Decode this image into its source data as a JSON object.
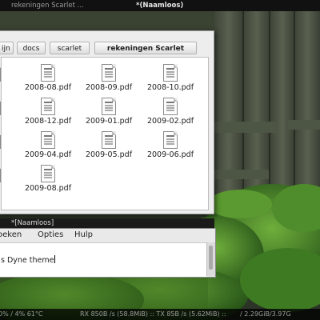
{
  "taskbar": {
    "tasks": [
      {
        "title": "rekeningen Scarlet ..."
      },
      {
        "title": "*(Naamloos)"
      }
    ]
  },
  "file_manager": {
    "breadcrumbs": [
      "ijn",
      "docs",
      "scarlet",
      "rekeningen Scarlet"
    ],
    "files": [
      {
        "name": "pdf"
      },
      {
        "name": "2008-08.pdf"
      },
      {
        "name": "2008-09.pdf"
      },
      {
        "name": "2008-10.pdf"
      },
      {
        "name": "pdf"
      },
      {
        "name": "2008-12.pdf"
      },
      {
        "name": "2009-01.pdf"
      },
      {
        "name": "2009-02.pdf"
      },
      {
        "name": "pdf"
      },
      {
        "name": "2009-04.pdf"
      },
      {
        "name": "2009-05.pdf"
      },
      {
        "name": "2009-06.pdf"
      },
      {
        "name": "pdf"
      },
      {
        "name": "2009-08.pdf"
      }
    ],
    "file_icon": "pdf-document-icon"
  },
  "editor": {
    "title": "*[Naamloos]",
    "menus": [
      "oeken",
      "Opties",
      "Hulp"
    ],
    "text": "s Dyne theme"
  },
  "statusbar": {
    "cpu": "0% / 4% 61°C",
    "net": "RX 850B /s (58.8MiB) :: TX 85B /s (5.62MiB) ::",
    "mem": "/ 2.29GiB/3.97G"
  },
  "colors": {
    "window_bg": "#ededed",
    "content_bg": "#ffffff",
    "taskbar_bg": "#111111"
  }
}
